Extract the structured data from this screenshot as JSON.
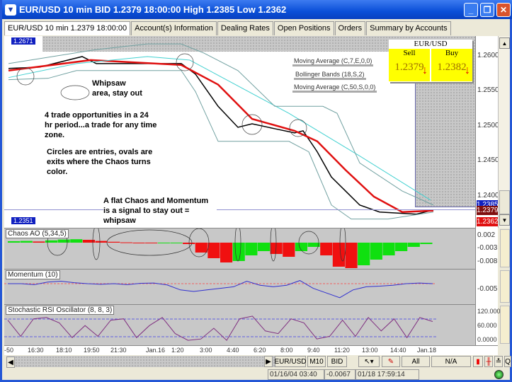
{
  "window": {
    "title": "EUR/USD 10 min BID 1.2379 18:00:00 High 1.2385 Low 1.2362",
    "controls": [
      "minimize",
      "restore",
      "close"
    ]
  },
  "tabs": [
    {
      "label": "EUR/USD 10 min 1.2379 18:00:00",
      "active": true
    },
    {
      "label": "Account(s) Information"
    },
    {
      "label": "Dealing Rates"
    },
    {
      "label": "Open Positions"
    },
    {
      "label": "Orders"
    },
    {
      "label": "Summary by Accounts"
    }
  ],
  "quote": {
    "symbol": "EUR/USD",
    "sell_label": "Sell",
    "sell": "1.2379",
    "buy_label": "Buy",
    "buy": "1.2382",
    "direction": "down"
  },
  "price_axis": {
    "ticks": [
      "1.2600",
      "1.2550",
      "1.2500",
      "1.2450",
      "1.2400"
    ],
    "high_tag": "1.2671",
    "low_tag": "1.2351",
    "tags": {
      "top": "1.2385",
      "current": "1.2379",
      "low": "1.2362"
    }
  },
  "legend": [
    "Moving Average (C,7,E,0,0)",
    "Bollinger Bands (18,S,2)",
    "Moving Average (C,50,S,0,0)"
  ],
  "annotations": {
    "whipsaw": "Whipsaw\narea, stay out",
    "opportunities": "4 trade opportunities in a 24 hr period...a trade for any time zone.",
    "circles": "Circles are entries, ovals are exits where the Chaos turns color.",
    "flat": "A flat Chaos and Momentum is a signal to stay out = whipsaw"
  },
  "chart_data": {
    "type": "line",
    "x_unit": "10-min bar index",
    "ylim": [
      1.2351,
      1.2671
    ],
    "series": [
      {
        "name": "Moving Average (C,7,E,0,0)",
        "color": "#000000",
        "x": [
          1,
          12,
          27,
          32,
          62,
          67,
          75,
          82,
          87,
          95,
          102,
          105,
          110,
          115,
          120,
          125,
          132,
          145,
          151
        ],
        "values": [
          1.2581,
          1.2583,
          1.2598,
          1.2588,
          1.2588,
          1.2573,
          1.2527,
          1.2497,
          1.2502,
          1.2495,
          1.2489,
          1.2492,
          1.2462,
          1.2426,
          1.2406,
          1.2386,
          1.2376,
          1.2373,
          1.2379
        ]
      },
      {
        "name": "Moving Average (C,50,S,0,0)",
        "color": "#e01010",
        "x": [
          1,
          30,
          62,
          75,
          87,
          102,
          110,
          120,
          130,
          140,
          151
        ],
        "values": [
          1.2578,
          1.2593,
          1.2586,
          1.2558,
          1.2509,
          1.2492,
          1.2477,
          1.2436,
          1.2398,
          1.2376,
          1.2378
        ]
      },
      {
        "name": "Bollinger Bands (18,S,2) middle",
        "color": "#40d0d0",
        "x": [
          1,
          25,
          50,
          65,
          100,
          125,
          150
        ],
        "values": [
          1.2568,
          1.2588,
          1.2598,
          1.2593,
          1.2517,
          1.2456,
          1.2393
        ]
      },
      {
        "name": "Bollinger upper",
        "color": "#70a0a0",
        "x": [
          1,
          32,
          50,
          62,
          70,
          82,
          95,
          112,
          117,
          125,
          140,
          151
        ],
        "values": [
          1.2588,
          1.2608,
          1.2616,
          1.2616,
          1.2603,
          1.2578,
          1.2527,
          1.2527,
          1.2517,
          1.2446,
          1.2406,
          1.2386
        ]
      },
      {
        "name": "Bollinger lower",
        "color": "#70a0a0",
        "x": [
          1,
          15,
          25,
          62,
          67,
          75,
          85,
          100,
          107,
          115,
          122,
          135,
          151
        ],
        "values": [
          1.2565,
          1.2567,
          1.2578,
          1.2578,
          1.2548,
          1.2477,
          1.2477,
          1.2477,
          1.2462,
          1.2386,
          1.2366,
          1.2366,
          1.2376
        ]
      }
    ]
  },
  "indicators": {
    "chaos": {
      "title": "Chaos AO (5,34,5)",
      "ticks": [
        "0.002",
        "-0.003",
        "-0.008"
      ],
      "values": [
        0.0005,
        0.0006,
        0.0004,
        0.0008,
        0.0011,
        0.0012,
        0.001,
        0.0006,
        0.0003,
        0.0001,
        -0.0001,
        -0.0002,
        -0.0002,
        -0.0001,
        -0.0005,
        -0.0035,
        -0.0055,
        -0.007,
        -0.0065,
        -0.0045,
        -0.003,
        -0.004,
        -0.005,
        -0.003,
        -0.0015,
        -0.0045,
        -0.0085,
        -0.009,
        -0.008,
        -0.006,
        -0.0045,
        -0.003,
        -0.0015,
        -0.0005
      ]
    },
    "momentum": {
      "title": "Momentum (10)",
      "ticks": [
        "-0.005"
      ],
      "values": [
        0,
        0,
        -0.0003,
        0.0005,
        0.0008,
        0.0003,
        0,
        -0.0002,
        0,
        -0.0003,
        0.0001,
        0.0002,
        -0.0004,
        -0.002,
        -0.0025,
        -0.002,
        -0.0015,
        -0.001,
        0.0008,
        -0.0005,
        -0.001,
        -0.0005,
        0.001,
        -0.0015,
        -0.003,
        -0.0045,
        -0.002,
        -0.001,
        -0.0008,
        -0.0005,
        0,
        0.0002,
        0
      ]
    },
    "stoch": {
      "title": "Stochastic RSI Oscillator (8, 8, 3)",
      "ticks": [
        "120.000",
        "60.000",
        "0.0000"
      ],
      "values": [
        80,
        20,
        85,
        90,
        70,
        15,
        60,
        20,
        80,
        85,
        15,
        60,
        90,
        30,
        5,
        10,
        50,
        5,
        85,
        95,
        40,
        30,
        85,
        70,
        10,
        20,
        80,
        20,
        90,
        40,
        85,
        15,
        90,
        75
      ]
    }
  },
  "time_axis": [
    "-50",
    "16:30",
    "18:10",
    "19:50",
    "21:30",
    "Jan.16",
    "1:20",
    "3:00",
    "4:40",
    "6:20",
    "8:00",
    "9:40",
    "11:20",
    "13:00",
    "14:40",
    "Jan.18"
  ],
  "toolbar": {
    "symbol": "EUR/USD",
    "period": "M10",
    "side": "BID",
    "all": "All",
    "na": "N/A"
  },
  "status": {
    "cursor_time": "01/16/04 03:40",
    "cursor_value": "-0.0067",
    "server_time": "01/18 17:59:14"
  }
}
